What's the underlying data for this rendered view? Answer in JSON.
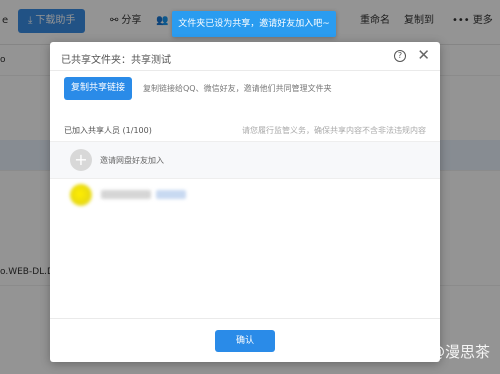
{
  "toolbar": {
    "left_stub": "e",
    "download_helper": "下载助手",
    "share": "分享",
    "rename": "重命名",
    "copy_to": "复制到",
    "more": "更多"
  },
  "file_list": {
    "left_stub": "o",
    "partial_filename": "o.WEB-DL.DD5"
  },
  "toast": {
    "text": "文件夹已设为共享，邀请好友加入吧~"
  },
  "dialog": {
    "title": "已共享文件夹：共享测试",
    "copy_link_button": "复制共享链接",
    "copy_hint": "复制链接给QQ、微信好友，邀请他们共同管理文件夹",
    "members_label": "已加入共享人员 (1/100)",
    "members_note": "请您履行监管义务，确保共享内容不含非法违规内容",
    "invite_label": "邀请网盘好友加入",
    "confirm_button": "确认"
  },
  "watermark": "知乎 @漫思茶"
}
